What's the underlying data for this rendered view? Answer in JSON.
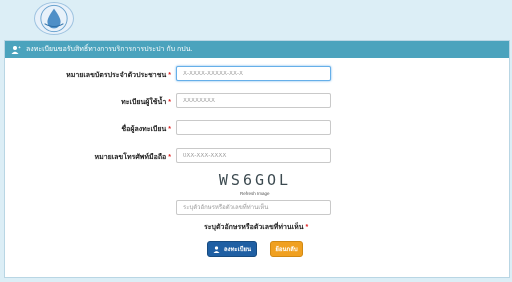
{
  "header": {
    "title": "ลงทะเบียนขอรับสิทธิ์ทางการบริการการประปา กับ กปน."
  },
  "form": {
    "fields": [
      {
        "label": "หมายเลขบัตรประจำตัวประชาชน",
        "required": true,
        "placeholder": "X-XXXX-XXXXX-XX-X",
        "value": ""
      },
      {
        "label": "ทะเบียนผู้ใช้น้ำ",
        "required": true,
        "placeholder": "XXXXXXXX",
        "value": ""
      },
      {
        "label": "ชื่อผู้ลงทะเบียน",
        "required": true,
        "placeholder": "",
        "value": ""
      },
      {
        "label": "หมายเลขโทรศัพท์มือถือ",
        "required": true,
        "placeholder": "0XX-XXX-XXXX",
        "value": ""
      }
    ],
    "required_mark": "*",
    "captcha": {
      "code": "WS6GOL",
      "refresh_label": "Refresh Image",
      "input_placeholder": "ระบุตัวอักษรหรือตัวเลขที่ท่านเห็น",
      "note": "ระบุตัวอักษรหรือตัวเลขที่ท่านเห็น"
    }
  },
  "actions": {
    "register_label": "ลงทะเบียน",
    "back_label": "ย้อนกลับ"
  },
  "icons": {
    "logo": "water-authority-logo-icon",
    "header": "user-plus-icon",
    "register": "user-icon"
  },
  "colors": {
    "header_bg": "#4ba3bd",
    "page_bg": "#dceef6",
    "primary_button": "#1f5fa3",
    "secondary_button": "#f0a020",
    "required": "#e02020"
  }
}
